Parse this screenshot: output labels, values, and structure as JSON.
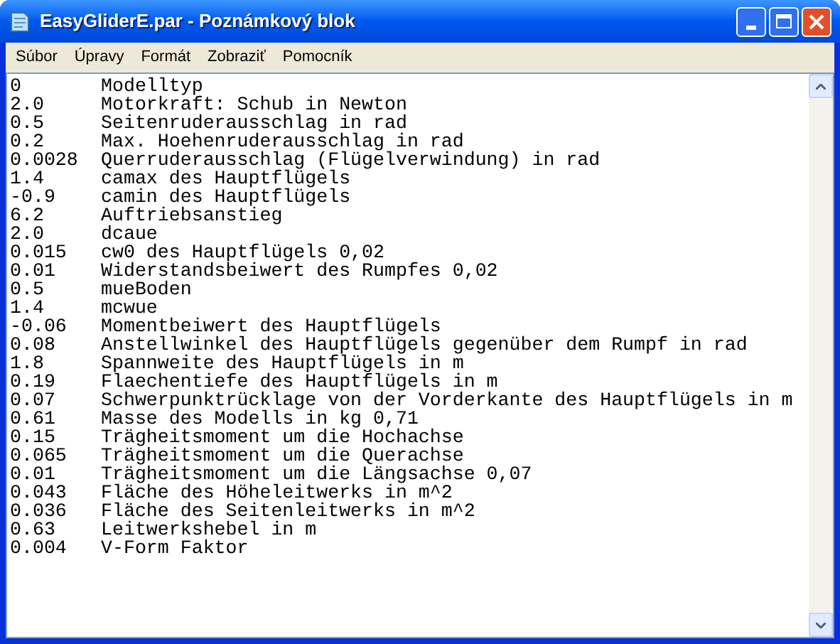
{
  "window": {
    "title": "EasyGliderE.par - Poznámkový blok"
  },
  "menu": [
    "Súbor",
    "Úpravy",
    "Formát",
    "Zobraziť",
    "Pomocník"
  ],
  "lines": [
    {
      "value": "0",
      "text": "Modelltyp"
    },
    {
      "value": "2.0",
      "text": "Motorkraft: Schub in Newton"
    },
    {
      "value": "0.5",
      "text": "Seitenruderausschlag in rad"
    },
    {
      "value": "0.2",
      "text": "Max. Hoehenruderausschlag in rad"
    },
    {
      "value": "0.0028",
      "text": "Querruderausschlag (Flügelverwindung) in rad"
    },
    {
      "value": "1.4",
      "text": "camax des Hauptflügels"
    },
    {
      "value": "-0.9",
      "text": "camin des Hauptflügels"
    },
    {
      "value": "6.2",
      "text": "Auftriebsanstieg"
    },
    {
      "value": "2.0",
      "text": "dcaue"
    },
    {
      "value": "0.015",
      "text": "cw0 des Hauptflügels 0,02"
    },
    {
      "value": "0.01",
      "text": "Widerstandsbeiwert des Rumpfes 0,02"
    },
    {
      "value": "0.5",
      "text": "mueBoden"
    },
    {
      "value": "1.4",
      "text": "mcwue"
    },
    {
      "value": "-0.06",
      "text": "Momentbeiwert des Hauptflügels"
    },
    {
      "value": "0.08",
      "text": "Anstellwinkel des Hauptflügels gegenüber dem Rumpf in rad"
    },
    {
      "value": "1.8",
      "text": "Spannweite des Hauptflügels in m"
    },
    {
      "value": "0.19",
      "text": "Flaechentiefe des Hauptflügels in m"
    },
    {
      "value": "0.07",
      "text": "Schwerpunktrücklage von der Vorderkante des Hauptflügels in m"
    },
    {
      "value": "0.61",
      "text": "Masse des Modells in kg 0,71"
    },
    {
      "value": "0.15",
      "text": "Trägheitsmoment um die Hochachse"
    },
    {
      "value": "0.065",
      "text": "Trägheitsmoment um die Querachse"
    },
    {
      "value": "0.01",
      "text": "Trägheitsmoment um die Längsachse 0,07"
    },
    {
      "value": "0.043",
      "text": "Fläche des Höheleitwerks in m^2"
    },
    {
      "value": "0.036",
      "text": "Fläche des Seitenleitwerks in m^2"
    },
    {
      "value": "0.63",
      "text": "Leitwerkshebel in m"
    },
    {
      "value": "0.004",
      "text": "V-Form Faktor"
    }
  ]
}
